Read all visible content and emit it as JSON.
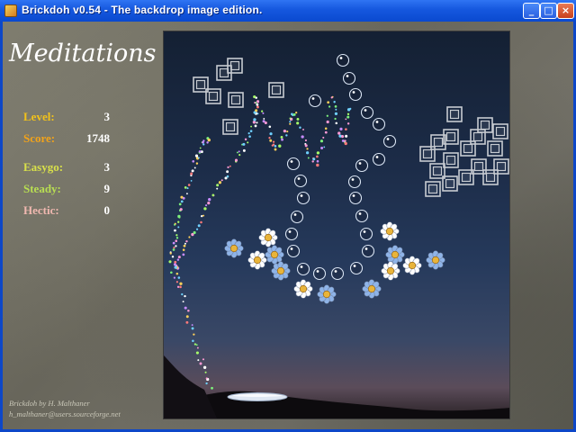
{
  "window": {
    "title": "Brickdoh v0.54 - The backdrop image edition.",
    "buttons": {
      "minimize": "_",
      "maximize": "□",
      "close": "×"
    }
  },
  "sidebar": {
    "heading": "Meditations",
    "stats": [
      {
        "label": "Level:",
        "value": "3",
        "color": "#f2c21a"
      },
      {
        "label": "Score:",
        "value": "1748",
        "color": "#f2a31a"
      },
      {
        "label": "Easygo:",
        "value": "3",
        "color": "#d8e04a"
      },
      {
        "label": "Steady:",
        "value": "9",
        "color": "#b8de52"
      },
      {
        "label": "Hectic:",
        "value": "0",
        "color": "#f0b8b0"
      }
    ],
    "credits": {
      "line1": "Brickdoh by H. Malthaner",
      "line2": "h_malthaner@users.sourceforge.net"
    }
  },
  "playfield": {
    "icons": [
      "brick-square-icon",
      "bubble-icon",
      "flower-icon",
      "paddle-icon",
      "firework-trail"
    ],
    "colors": {
      "brick": "#c7cbd1",
      "bubble": "#dbe6f5",
      "flower_white": "#ffffff",
      "flower_blue": "#8fb4e8",
      "flower_center": "#e8b43a",
      "paddle": "#d9e2ee"
    }
  }
}
